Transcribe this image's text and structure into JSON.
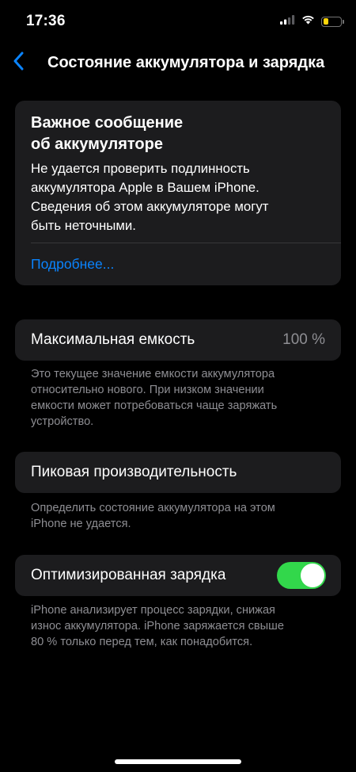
{
  "status_bar": {
    "time": "17:36",
    "battery_level": 0.3,
    "battery_color": "#ffd60a",
    "icons": [
      "signal-icon",
      "wifi-icon",
      "battery-icon"
    ]
  },
  "nav": {
    "back_icon": "chevron-left-icon",
    "title": "Состояние аккумулятора и зарядка"
  },
  "alert": {
    "title_line1": "Важное сообщение",
    "title_line2": "об аккумуляторе",
    "body_line1": "Не удается проверить подлинность",
    "body_line2": "аккумулятора Apple в Вашем iPhone.",
    "body_line3": "Сведения об этом аккумуляторе могут",
    "body_line4": "быть неточными.",
    "link": "Подробнее..."
  },
  "capacity": {
    "label": "Максимальная емкость",
    "value": "100 %",
    "footnote_line1": "Это текущее значение емкости аккумулятора",
    "footnote_line2": "относительно нового. При низком значении",
    "footnote_line3": "емкости может потребоваться чаще заряжать",
    "footnote_line4": "устройство."
  },
  "peak": {
    "label": "Пиковая производительность",
    "footnote_line1": "Определить состояние аккумулятора на этом",
    "footnote_line2": "iPhone не удается."
  },
  "charging": {
    "label": "Оптимизированная зарядка",
    "enabled": true,
    "toggle_color": "#32d74b",
    "footnote_line1": "iPhone анализирует процесс зарядки, снижая",
    "footnote_line2": "износ аккумулятора. iPhone заряжается свыше",
    "footnote_line3": "80 % только перед тем, как понадобится."
  },
  "colors": {
    "background": "#000000",
    "card": "#1c1c1e",
    "accent": "#0a84ff",
    "secondary_text": "#8e8e93"
  }
}
